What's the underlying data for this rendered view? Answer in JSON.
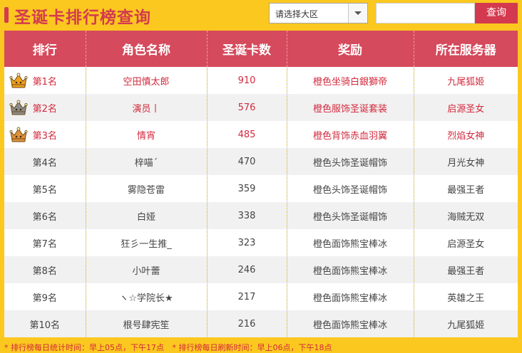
{
  "header": {
    "title": "圣诞卡排行榜查询",
    "region_placeholder": "请选择大区",
    "search_value": "",
    "search_button": "查询"
  },
  "table": {
    "columns": [
      "排行",
      "角色名称",
      "圣诞卡数",
      "奖励",
      "所在服务器"
    ],
    "rows": [
      {
        "rank": "第1名",
        "name": "空田慎太郎",
        "cards": "910",
        "reward": "橙色坐骑白銀獅帝",
        "server": "九尾狐姬",
        "crown": "gold"
      },
      {
        "rank": "第2名",
        "name": "演员丨",
        "cards": "576",
        "reward": "橙色服饰圣诞套装",
        "server": "启源圣女",
        "crown": "silver"
      },
      {
        "rank": "第3名",
        "name": "情宵",
        "cards": "485",
        "reward": "橙色背饰赤血羽翼",
        "server": "烈焰女神",
        "crown": "bronze"
      },
      {
        "rank": "第4名",
        "name": "梓喵´",
        "cards": "470",
        "reward": "橙色头饰圣诞帽饰",
        "server": "月光女神"
      },
      {
        "rank": "第5名",
        "name": "雾隐苍雷",
        "cards": "359",
        "reward": "橙色头饰圣诞帽饰",
        "server": "最强王者"
      },
      {
        "rank": "第6名",
        "name": "白娅",
        "cards": "338",
        "reward": "橙色头饰圣诞帽饰",
        "server": "海贼无双"
      },
      {
        "rank": "第7名",
        "name": "狂彡一生推_",
        "cards": "323",
        "reward": "橙色面饰熊宝棒冰",
        "server": "启源圣女"
      },
      {
        "rank": "第8名",
        "name": "小叶蕾",
        "cards": "246",
        "reward": "橙色面饰熊宝棒冰",
        "server": "最强王者"
      },
      {
        "rank": "第9名",
        "name": "ヽ☆学院长★",
        "cards": "217",
        "reward": "橙色面饰熊宝棒冰",
        "server": "英雄之王"
      },
      {
        "rank": "第10名",
        "name": "根号肆宪笙",
        "cards": "216",
        "reward": "橙色面饰熊宝棒冰",
        "server": "九尾狐姬"
      }
    ]
  },
  "footer": {
    "note1": "* 排行榜每日统计时间：早上05点，下午17点",
    "note2": "* 排行榜每日刷新时间：早上06点，下午18点"
  },
  "colors": {
    "background": "#fbc81f",
    "accent": "#d33b4f",
    "header_row": "#d54a5c",
    "crown_gold": "#f0a020",
    "crown_silver": "#8c8c8c",
    "crown_bronze": "#e0913a"
  },
  "icons": {
    "crown": "crown-icon",
    "dropdown": "chevron-down-icon"
  }
}
